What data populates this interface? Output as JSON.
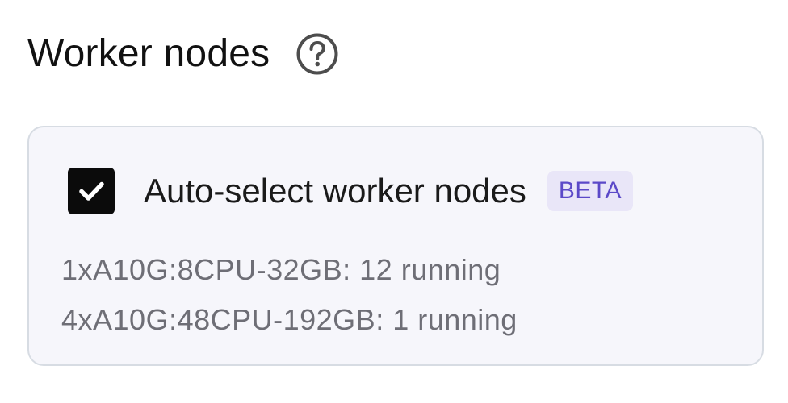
{
  "header": {
    "title": "Worker nodes",
    "help_icon": "question-circle-icon"
  },
  "auto_select": {
    "checked": true,
    "label": "Auto-select worker nodes",
    "badge": "BETA",
    "checkbox_icon": "checkmark-icon"
  },
  "nodes": [
    {
      "text": "1xA10G:8CPU-32GB: 12 running"
    },
    {
      "text": "4xA10G:48CPU-192GB: 1 running"
    }
  ],
  "colors": {
    "badge_text": "#5b49c8",
    "badge_bg": "#e9e6f8",
    "panel_bg": "#f6f6fb",
    "panel_border": "#d7dce3",
    "checkbox_bg": "#0b0b0b"
  }
}
